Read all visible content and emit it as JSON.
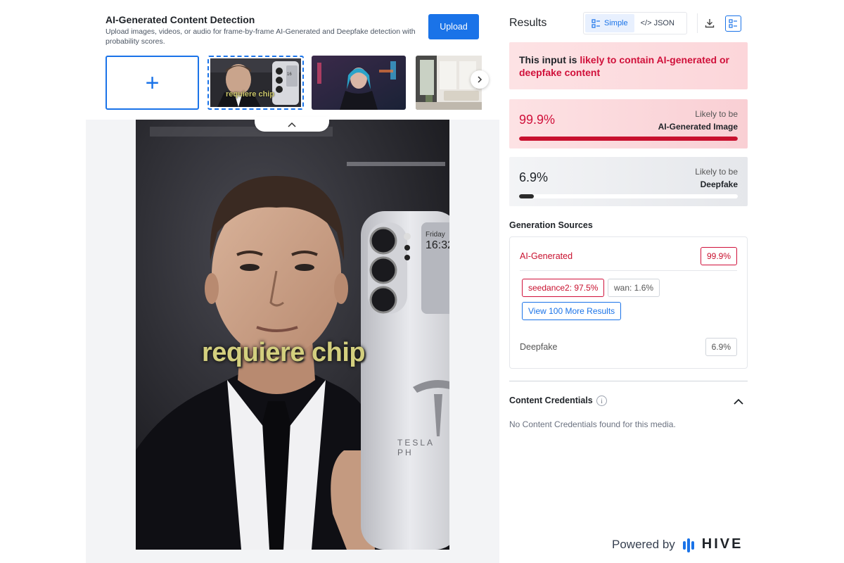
{
  "upload_panel": {
    "title": "AI-Generated Content Detection",
    "subtitle": "Upload images, videos, or audio for frame-by-frame AI-Generated and Deepfake detection with probability scores.",
    "upload_button": "Upload",
    "thumbnail_1_caption": "requiere chip"
  },
  "preview": {
    "caption": "requiere chip",
    "phone_day": "Friday",
    "phone_time": "16:32",
    "phone_brand": "TESLA PH"
  },
  "results": {
    "title": "Results",
    "view_simple": "Simple",
    "view_json": "</> JSON",
    "verdict_prefix": "This input is ",
    "verdict_highlight": "likely to contain AI-generated or deepfake content",
    "ai_score": "99.9%",
    "ai_score_fraction": 0.999,
    "ai_label_top": "Likely to be",
    "ai_label_bottom": "AI-Generated Image",
    "df_score": "6.9%",
    "df_score_fraction": 0.069,
    "df_label_top": "Likely to be",
    "df_label_bottom": "Deepfake"
  },
  "generation_sources": {
    "title": "Generation Sources",
    "ai_label": "AI-Generated",
    "ai_value": "99.9%",
    "sources": [
      "seedance2: 97.5%",
      "wan: 1.6%"
    ],
    "more_button": "View 100 More Results",
    "deepfake_label": "Deepfake",
    "deepfake_value": "6.9%"
  },
  "content_credentials": {
    "title": "Content Credentials",
    "info": "i",
    "message": "No Content Credentials found for this media."
  },
  "footer": {
    "powered_by": "Powered by",
    "brand": "HIVE"
  },
  "colors": {
    "accent": "#1a73e8",
    "danger": "#c8102e"
  }
}
